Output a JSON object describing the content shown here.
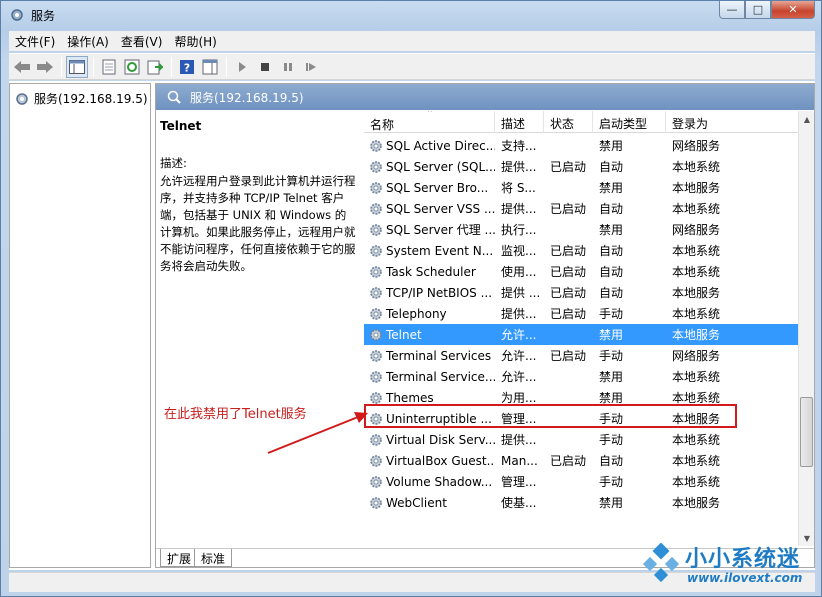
{
  "window": {
    "title": "服务",
    "controls": [
      "—",
      "□",
      "✕"
    ]
  },
  "menu": [
    "文件(F)",
    "操作(A)",
    "查看(V)",
    "帮助(H)"
  ],
  "tree": {
    "root": "服务(192.168.19.5)"
  },
  "pane": {
    "header": "服务(192.168.19.5)",
    "service_title": "Telnet",
    "desc_label": "描述:",
    "desc_text": "允许远程用户登录到此计算机并运行程序，并支持多种 TCP/IP Telnet 客户端，包括基于 UNIX 和 Windows 的计算机。如果此服务停止，远程用户就不能访问程序，任何直接依赖于它的服务将会启动失败。"
  },
  "annotation": "在此我禁用了Telnet服务",
  "columns": [
    "名称",
    "描述",
    "状态",
    "启动类型",
    "登录为"
  ],
  "services": [
    {
      "name": "SQL Active Direc...",
      "desc": "支持...",
      "status": "",
      "type": "禁用",
      "logon": "网络服务"
    },
    {
      "name": "SQL Server (SQL...",
      "desc": "提供...",
      "status": "已启动",
      "type": "自动",
      "logon": "本地系统"
    },
    {
      "name": "SQL Server Bro...",
      "desc": "将 S...",
      "status": "",
      "type": "禁用",
      "logon": "本地服务"
    },
    {
      "name": "SQL Server VSS ...",
      "desc": "提供...",
      "status": "已启动",
      "type": "自动",
      "logon": "本地系统"
    },
    {
      "name": "SQL Server 代理 ...",
      "desc": "执行...",
      "status": "",
      "type": "禁用",
      "logon": "网络服务"
    },
    {
      "name": "System Event N...",
      "desc": "监视...",
      "status": "已启动",
      "type": "自动",
      "logon": "本地系统"
    },
    {
      "name": "Task Scheduler",
      "desc": "使用...",
      "status": "已启动",
      "type": "自动",
      "logon": "本地系统"
    },
    {
      "name": "TCP/IP NetBIOS ...",
      "desc": "提供 ...",
      "status": "已启动",
      "type": "自动",
      "logon": "本地服务"
    },
    {
      "name": "Telephony",
      "desc": "提供...",
      "status": "已启动",
      "type": "手动",
      "logon": "本地系统"
    },
    {
      "name": "Telnet",
      "desc": "允许...",
      "status": "",
      "type": "禁用",
      "logon": "本地服务"
    },
    {
      "name": "Terminal Services",
      "desc": "允许...",
      "status": "已启动",
      "type": "手动",
      "logon": "网络服务"
    },
    {
      "name": "Terminal Service...",
      "desc": "允许...",
      "status": "",
      "type": "禁用",
      "logon": "本地系统"
    },
    {
      "name": "Themes",
      "desc": "为用...",
      "status": "",
      "type": "禁用",
      "logon": "本地系统"
    },
    {
      "name": "Uninterruptible ...",
      "desc": "管理...",
      "status": "",
      "type": "手动",
      "logon": "本地服务"
    },
    {
      "name": "Virtual Disk Serv...",
      "desc": "提供...",
      "status": "",
      "type": "手动",
      "logon": "本地系统"
    },
    {
      "name": "VirtualBox Guest...",
      "desc": "Man...",
      "status": "已启动",
      "type": "自动",
      "logon": "本地系统"
    },
    {
      "name": "Volume Shadow...",
      "desc": "管理...",
      "status": "",
      "type": "手动",
      "logon": "本地系统"
    },
    {
      "name": "WebClient",
      "desc": "使基...",
      "status": "",
      "type": "禁用",
      "logon": "本地服务"
    }
  ],
  "selected_service": "Telnet",
  "tabs": [
    "扩展",
    "标准"
  ],
  "watermark": {
    "title": "小小系统迷",
    "url": "www.ilovext.com"
  },
  "colors": {
    "selection": "#3399ff",
    "highlight_box": "#d21a1a",
    "annotation": "#c81e1e",
    "header": "#7a9cc8"
  }
}
